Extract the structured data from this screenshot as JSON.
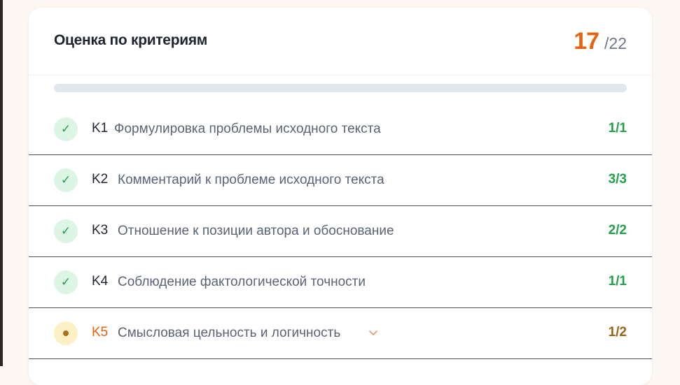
{
  "panel": {
    "title": "Оценка по критериям",
    "score": "17",
    "score_sep": "/",
    "score_max": "22",
    "progress_fraction": 0
  },
  "criteria": [
    {
      "code": "K1",
      "name": "Формулировка проблемы исходного текста",
      "score": "1/1",
      "status_icon": "check-icon"
    },
    {
      "code": "K2",
      "name": "Комментарий к проблеме исходного текста",
      "score": "3/3",
      "status_icon": "check-icon"
    },
    {
      "code": "K3",
      "name": "Отношение к позиции автора и обоснование",
      "score": "2/2",
      "status_icon": "check-icon"
    },
    {
      "code": "K4",
      "name": "Соблюдение фактологической точности",
      "score": "1/1",
      "status_icon": "check-icon"
    },
    {
      "code": "K5",
      "name": "Смысловая цельность и логичность",
      "score": "1/2",
      "status_icon": "dot-icon",
      "expand_icon": "chevron-down-icon"
    }
  ],
  "colors": {
    "accent_orange": "#e8620f",
    "success_green": "#23a04a",
    "partial_brown": "#9a6512",
    "track_gray": "#e1e7ef"
  }
}
